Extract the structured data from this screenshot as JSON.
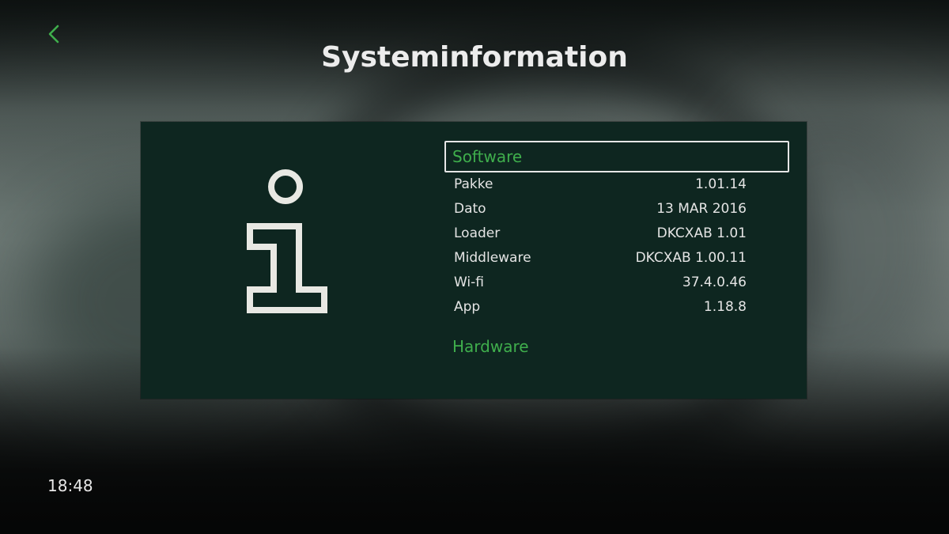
{
  "header": {
    "title": "Systeminformation",
    "back_icon": "chevron-left-icon"
  },
  "colors": {
    "accent": "#3fae4c",
    "panel_bg": "#0e2620",
    "text": "#e4e4e4",
    "focus_border": "#e6e6e6"
  },
  "panel": {
    "icon": "info-icon",
    "sections": {
      "software": {
        "title": "Software",
        "rows": [
          {
            "label": "Pakke",
            "value": "1.01.14"
          },
          {
            "label": "Dato",
            "value": "13 MAR 2016"
          },
          {
            "label": "Loader",
            "value": "DKCXAB 1.01"
          },
          {
            "label": "Middleware",
            "value": "DKCXAB 1.00.11"
          },
          {
            "label": "Wi-fi",
            "value": "37.4.0.46"
          },
          {
            "label": "App",
            "value": "1.18.8"
          }
        ]
      },
      "hardware": {
        "title": "Hardware"
      }
    }
  },
  "footer": {
    "clock": "18:48"
  }
}
